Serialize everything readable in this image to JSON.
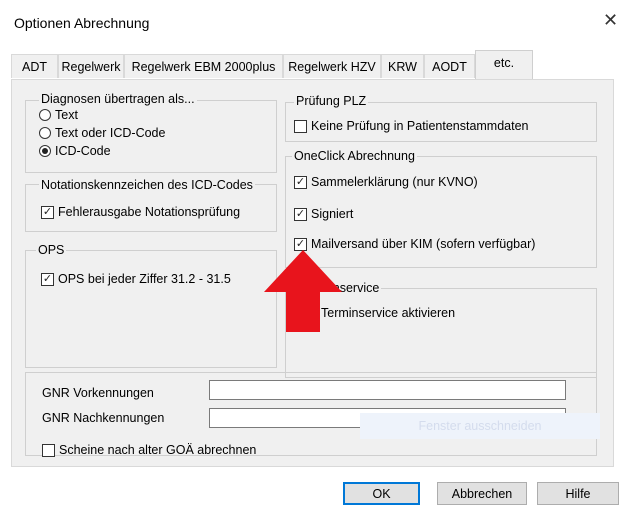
{
  "window": {
    "title": "Optionen Abrechnung",
    "close_glyph": "✕"
  },
  "tabs": [
    {
      "label": "ADT"
    },
    {
      "label": "Regelwerk"
    },
    {
      "label": "Regelwerk EBM 2000plus"
    },
    {
      "label": "Regelwerk HZV"
    },
    {
      "label": "KRW"
    },
    {
      "label": "AODT"
    },
    {
      "label": "etc."
    }
  ],
  "active_tab": "etc.",
  "diagnosen": {
    "title": "Diagnosen übertragen als...",
    "options": [
      {
        "label": "Text",
        "selected": false
      },
      {
        "label": "Text oder ICD-Code",
        "selected": false
      },
      {
        "label": "ICD-Code",
        "selected": true
      }
    ]
  },
  "notation": {
    "title": "Notationskennzeichen des ICD-Codes",
    "checkbox": {
      "label": "Fehlerausgabe Notationsprüfung",
      "checked": true
    }
  },
  "ops": {
    "title": "OPS",
    "checkbox": {
      "label": "OPS bei jeder Ziffer 31.2 - 31.5",
      "checked": true
    }
  },
  "pruefung_plz": {
    "title": "Prüfung PLZ",
    "checkbox": {
      "label": "Keine Prüfung in Patientenstammdaten",
      "checked": false
    }
  },
  "oneclick": {
    "title": "OneClick Abrechnung",
    "checkboxes": [
      {
        "label": "Sammelerklärung (nur KVNO)",
        "checked": true
      },
      {
        "label": "Signiert",
        "checked": true
      },
      {
        "label": "Mailversand über KIM (sofern verfügbar)",
        "checked": true
      }
    ]
  },
  "terminservice": {
    "title_visible": "inservice",
    "checkbox": {
      "label": "Terminservice aktivieren",
      "checked": false
    }
  },
  "gnr": {
    "vorkennungen_label": "GNR Vorkennungen",
    "vorkennungen_value": "",
    "nachkennungen_label": "GNR Nachkennungen",
    "nachkennungen_value": "",
    "goae_checkbox": {
      "label": "Scheine nach alter GOÄ abrechnen",
      "checked": false
    }
  },
  "overlay": {
    "faded_text": "Fenster ausschneiden",
    "arrow_color": "#e8141c"
  },
  "buttons": {
    "ok": "OK",
    "cancel": "Abbrechen",
    "help": "Hilfe"
  },
  "colors": {
    "dialog_bg": "#f0f0f0",
    "accent": "#0078d7",
    "arrow": "#e8141c"
  }
}
